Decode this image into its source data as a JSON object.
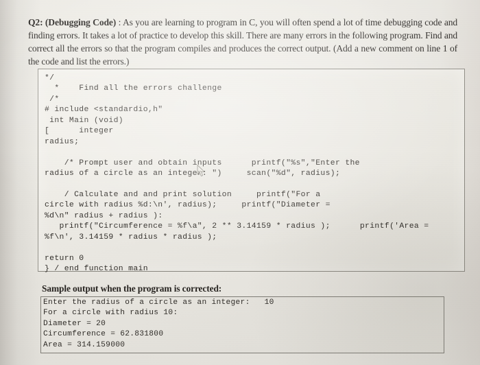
{
  "question": {
    "label": "Q2: (Debugging Code)",
    "body": " : As you are learning to program in C, you will often spend a lot of time debugging code and finding errors. It takes a lot of practice to develop this skill. There are many errors in the following program. Find and correct all the errors so that the program compiles and produces the correct output. (Add a new comment on line 1 of the code and list the errors.)"
  },
  "code": {
    "lines": [
      "*/",
      "  *    Find all the errors challenge",
      " /*",
      "# include <standardio,h\"",
      " int Main (void)",
      "[      integer",
      "radius;",
      "",
      "    /* Prompt user and obtain inputs      printf(\"%s\",\"Enter the",
      "radius of a circle as an integer: \")     scan(\"%d\", radius);",
      "",
      "    / Calculate and and print solution     printf(\"For a",
      "circle with radius %d:\\n', radius);     printf(\"Diameter =",
      "%d\\n\" radius + radius ):",
      "   printf(\"Circumference = %f\\a\", 2 ** 3.14159 * radius );      printf('Area =",
      "%f\\n', 3.14159 * radius * radius );",
      "",
      "return 0",
      "} / end function main"
    ]
  },
  "sample_output": {
    "caption": "Sample output when the program is corrected:",
    "lines": [
      "Enter the radius of a circle as an integer:   10",
      "For a circle with radius 10:",
      "Diameter = 20",
      "Circumference = 62.831800",
      "Area = 314.159000"
    ]
  },
  "cursor": {
    "icon": "mouse-pointer-icon"
  },
  "colors": {
    "paper": "#ebe9e3",
    "ink": "#25221f",
    "box_border": "#8a8880"
  }
}
